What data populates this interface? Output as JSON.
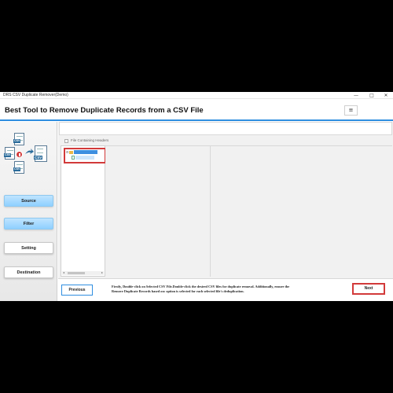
{
  "window": {
    "title": "DRS CSV Duplicate Remover(Demo)",
    "minimize_glyph": "—",
    "maximize_glyph": "□",
    "close_glyph": "✕"
  },
  "header": {
    "title": "Best Tool to Remove Duplicate Records from a CSV File",
    "menu_glyph": "≡"
  },
  "logo": {
    "doc_tags": [
      "CSV",
      "CSV",
      "CSV",
      "CSV"
    ],
    "icons": [
      "csv-file-icon",
      "delete-badge-icon",
      "arrow-right-icon"
    ]
  },
  "sidebar": {
    "items": [
      {
        "label": "Source",
        "active": true
      },
      {
        "label": "Filter",
        "active": true
      },
      {
        "label": "Setting",
        "active": false
      },
      {
        "label": "Destination",
        "active": false
      }
    ]
  },
  "main": {
    "header_checkbox_label": "File Containing Headers",
    "header_checkbox_checked": false
  },
  "footer": {
    "previous_label": "Previous",
    "instruction": "Firstly, Double-click on Selected CSV File.Double-click the desired CSV files for duplicate removal. Additionally, ensure the Remove Duplicate Records based on: option is selected for each selected file's deduplication.",
    "next_label": "Next"
  },
  "colors": {
    "accent": "#2f8ee0",
    "highlight_red": "#d23a3a",
    "active_nav": "#8fd0ff",
    "tree_selection": "#3d8fe0"
  }
}
